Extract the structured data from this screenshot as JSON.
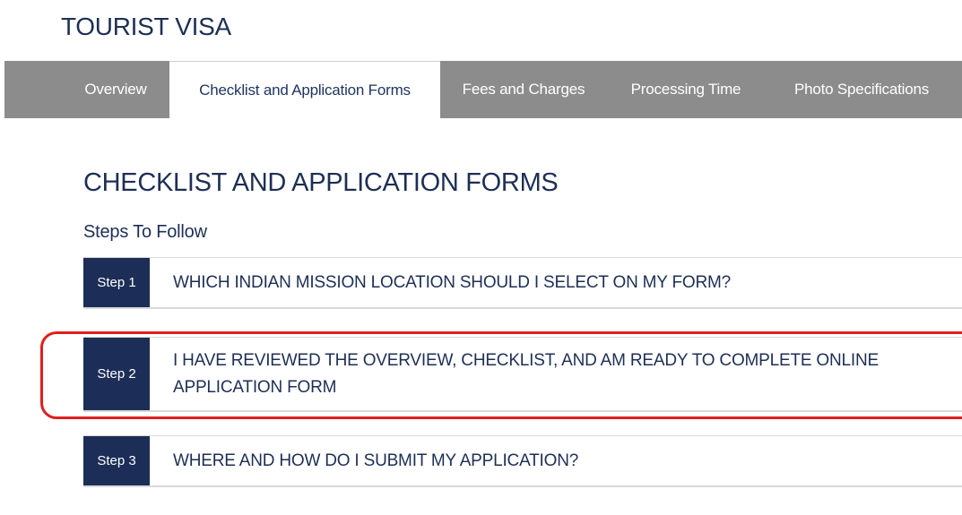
{
  "page": {
    "title": "TOURIST VISA"
  },
  "tabs": [
    {
      "label": "Overview"
    },
    {
      "label": "Checklist and Application Forms"
    },
    {
      "label": "Fees and Charges"
    },
    {
      "label": "Processing Time"
    },
    {
      "label": "Photo Specifications"
    }
  ],
  "active_tab_index": 1,
  "section": {
    "heading": "CHECKLIST AND APPLICATION FORMS",
    "subheading": "Steps To Follow"
  },
  "steps": [
    {
      "badge": "Step 1",
      "text": "WHICH INDIAN MISSION LOCATION SHOULD I SELECT ON MY FORM?"
    },
    {
      "badge": "Step 2",
      "text": "I HAVE REVIEWED THE OVERVIEW, CHECKLIST, AND AM READY TO COMPLETE ONLINE APPLICATION FORM"
    },
    {
      "badge": "Step 3",
      "text": "WHERE AND HOW DO I SUBMIT MY APPLICATION?"
    }
  ],
  "highlighted_step_index": 1,
  "colors": {
    "navy": "#1c2e57",
    "tabbar_gray": "#8c8c8c",
    "highlight_red": "#e01e1e"
  }
}
